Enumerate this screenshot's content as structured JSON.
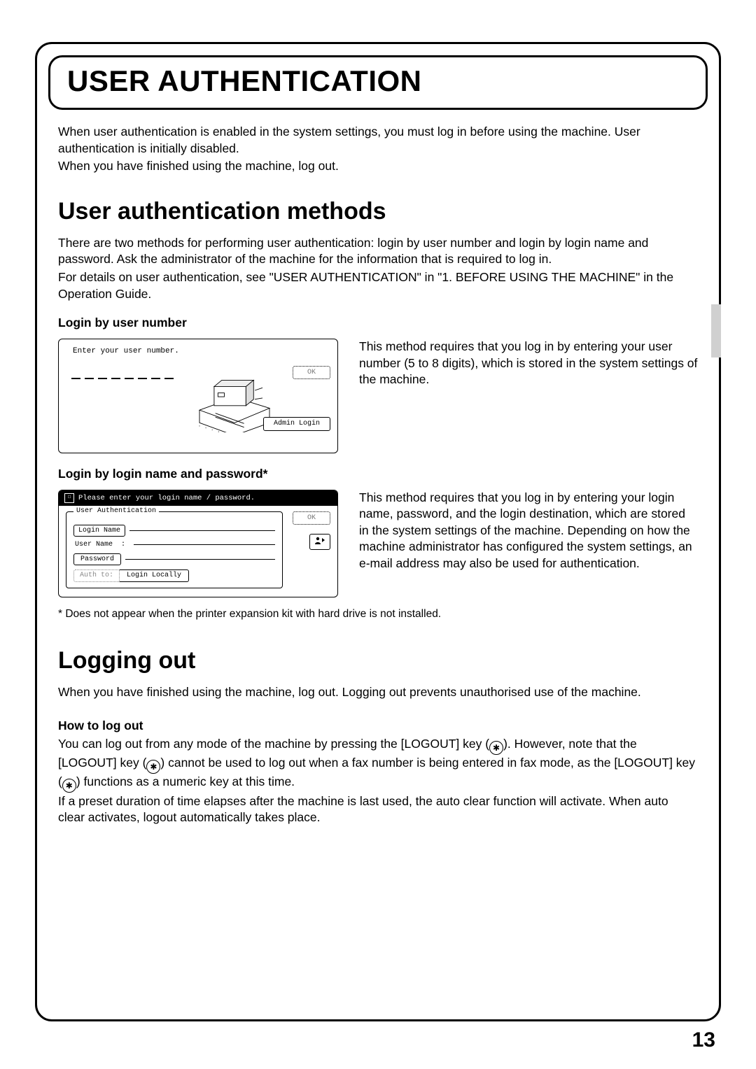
{
  "page_title": "USER AUTHENTICATION",
  "intro_p1": "When user authentication is enabled in the system settings, you must log in before using the machine. User authentication is initially disabled.",
  "intro_p2": "When you have finished using the machine, log out.",
  "section1": {
    "title": "User authentication methods",
    "desc": "There are two methods for performing user authentication: login by user number and login by login name and password. Ask the administrator of the machine for the information that is required to log in.",
    "desc2": "For details on user authentication, see \"USER AUTHENTICATION\" in \"1. BEFORE USING THE MACHINE\" in the Operation Guide."
  },
  "method1": {
    "heading": "Login by user number",
    "panel_prompt": "Enter your user number.",
    "ok_label": "OK",
    "admin_label": "Admin Login",
    "explain": "This method requires that you log in by entering your user number (5 to 8 digits), which is stored in the system settings of the machine."
  },
  "method2": {
    "heading": "Login by login name and password*",
    "panel_header": "Please enter your login name / password.",
    "group_legend": "User Authentication",
    "login_name_label": "Login Name",
    "user_name_label": "User Name",
    "colon": ":",
    "password_label": "Password",
    "auth_to_label": "Auth to:",
    "auth_to_value": "Login Locally",
    "ok_label": "OK",
    "explain": "This method requires that you log in by entering your login name, password, and the login destination, which are stored in the system settings of the machine. Depending on how the machine administrator has configured the system settings, an e-mail address may also be used for authentication."
  },
  "footnote": "* Does not appear when the printer expansion kit with hard drive is not installed.",
  "section2": {
    "title": "Logging out",
    "intro": "When you have finished using the machine, log out. Logging out prevents unauthorised use of the machine.",
    "howto_heading": "How to log out",
    "body1a": "You can log out from any mode of the machine by pressing the [LOGOUT] key (",
    "body1b": "). However, note that the [LOGOUT] key (",
    "body1c": ") cannot be used to log out when a fax number is being entered in fax mode, as the [LOGOUT] key (",
    "body1d": ") functions as a numeric key at this time.",
    "body2": "If a preset duration of time elapses after the machine is last used, the auto clear function will activate. When auto clear activates, logout automatically takes place.",
    "key_glyph": "✱"
  },
  "page_number": "13"
}
